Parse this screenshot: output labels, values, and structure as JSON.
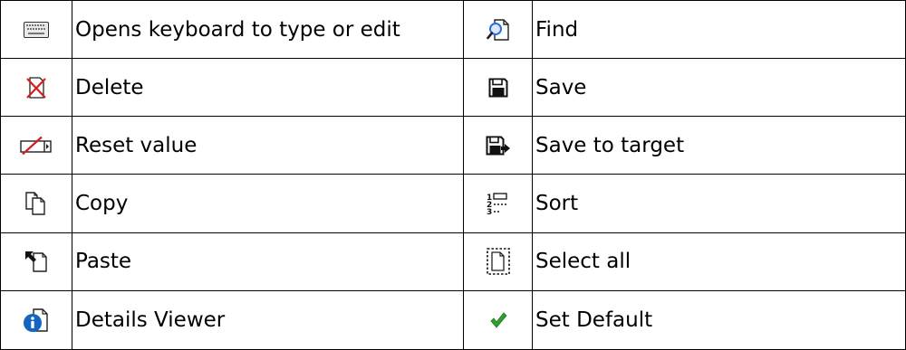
{
  "rows": [
    {
      "left": {
        "icon": "keyboard-icon",
        "label": "Opens keyboard to type or edit"
      },
      "right": {
        "icon": "find-icon",
        "label": "Find"
      }
    },
    {
      "left": {
        "icon": "delete-icon",
        "label": "Delete"
      },
      "right": {
        "icon": "save-icon",
        "label": "Save"
      }
    },
    {
      "left": {
        "icon": "reset-value-icon",
        "label": "Reset value"
      },
      "right": {
        "icon": "save-to-target-icon",
        "label": "Save to target"
      }
    },
    {
      "left": {
        "icon": "copy-icon",
        "label": "Copy"
      },
      "right": {
        "icon": "sort-icon",
        "label": "Sort"
      }
    },
    {
      "left": {
        "icon": "paste-icon",
        "label": "Paste"
      },
      "right": {
        "icon": "select-all-icon",
        "label": "Select all"
      }
    },
    {
      "left": {
        "icon": "details-viewer-icon",
        "label": "Details Viewer"
      },
      "right": {
        "icon": "set-default-icon",
        "label": "Set Default"
      }
    }
  ],
  "colors": {
    "delete_red": "#d21f1f",
    "info_blue": "#1565c0",
    "check_green": "#2e9e2e",
    "find_lens_blue": "#2f6fd6"
  }
}
